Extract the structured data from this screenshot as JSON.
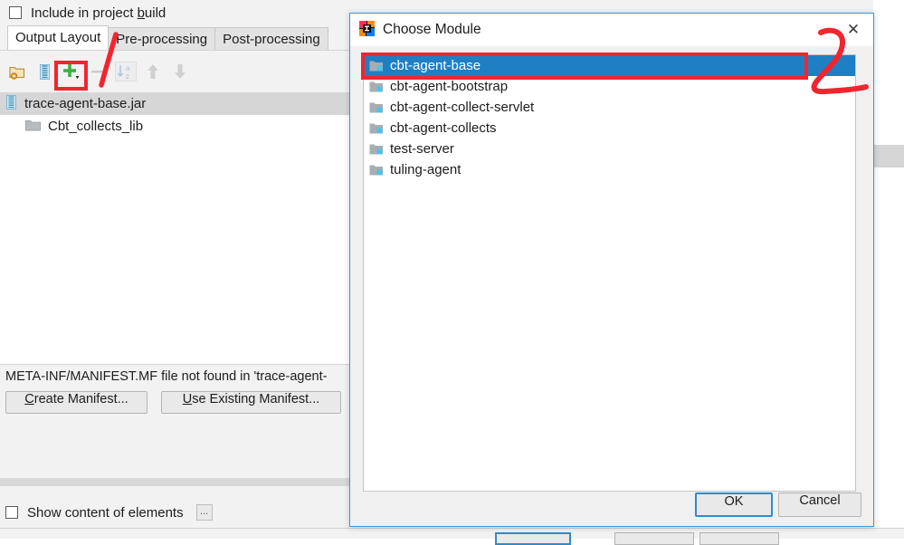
{
  "background": {
    "include_checkbox": {
      "label_before": "Include in project ",
      "label_mnemonic": "b",
      "label_after": "uild",
      "checked": false
    },
    "tabs": [
      {
        "label": "Output Layout",
        "active": true
      },
      {
        "label": "Pre-processing",
        "active": false
      },
      {
        "label": "Post-processing",
        "active": false
      }
    ],
    "toolbar": [
      {
        "name": "add-directory-icon",
        "tooltip": "Create Directory"
      },
      {
        "name": "add-archive-icon",
        "tooltip": "Create Archive"
      },
      {
        "name": "add-icon",
        "tooltip": "Add Copy of"
      },
      {
        "name": "remove-icon",
        "tooltip": "Remove"
      },
      {
        "name": "sort-alphabetically-icon",
        "tooltip": "Sort"
      },
      {
        "name": "move-up-icon",
        "tooltip": "Move Up"
      },
      {
        "name": "move-down-icon",
        "tooltip": "Move Down"
      }
    ],
    "tree": [
      {
        "label": "trace-agent-base.jar",
        "icon": "archive-icon",
        "selected": true,
        "indent": 0
      },
      {
        "label": "Cbt_collects_lib",
        "icon": "folder-icon",
        "selected": false,
        "indent": 1
      }
    ],
    "manifest_message": "META-INF/MANIFEST.MF file not found in 'trace-agent-",
    "buttons": [
      {
        "name": "create-manifest-button",
        "mnemonic": "C",
        "rest": "reate Manifest..."
      },
      {
        "name": "use-existing-manifest-button",
        "mnemonic": "U",
        "rest": "se Existing Manifest..."
      }
    ],
    "show_content_checkbox": {
      "label": "Show content of elements",
      "checked": false
    },
    "ellipsis_button_label": "..."
  },
  "dialog": {
    "title": "Choose Module",
    "app_icon": "intellij-idea-icon",
    "close_icon": "✕",
    "modules": [
      {
        "label": "cbt-agent-base",
        "selected": true
      },
      {
        "label": "cbt-agent-bootstrap",
        "selected": false
      },
      {
        "label": "cbt-agent-collect-servlet",
        "selected": false
      },
      {
        "label": "cbt-agent-collects",
        "selected": false
      },
      {
        "label": "test-server",
        "selected": false
      },
      {
        "label": "tuling-agent",
        "selected": false
      }
    ],
    "ok_label": "OK",
    "cancel_label": "Cancel"
  },
  "annotations": {
    "color": "#f2252f",
    "marks": [
      {
        "name": "highlight-box-add-button",
        "shape": "rectangle"
      },
      {
        "name": "stroke-one",
        "shape": "slash",
        "meaning": "1"
      },
      {
        "name": "highlight-box-selected-module",
        "shape": "rectangle"
      },
      {
        "name": "digit-two",
        "shape": "handwritten",
        "meaning": "2"
      }
    ]
  },
  "colors": {
    "selection_blue": "#1f7fc4",
    "dialog_border": "#3f96d6",
    "annotation_red": "#f2252f",
    "window_gray": "#f0f0f0"
  }
}
